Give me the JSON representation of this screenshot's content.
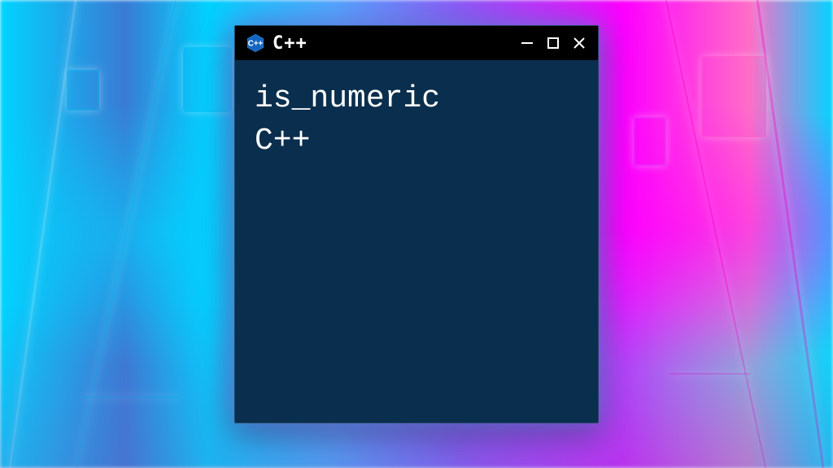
{
  "window": {
    "title": "C++",
    "icon_name": "cpp-hexagon-icon"
  },
  "content": {
    "line1": "is_numeric",
    "line2": "C++"
  },
  "colors": {
    "window_bg": "#0a2e4d",
    "titlebar_bg": "#000000",
    "text": "#ffffff"
  }
}
